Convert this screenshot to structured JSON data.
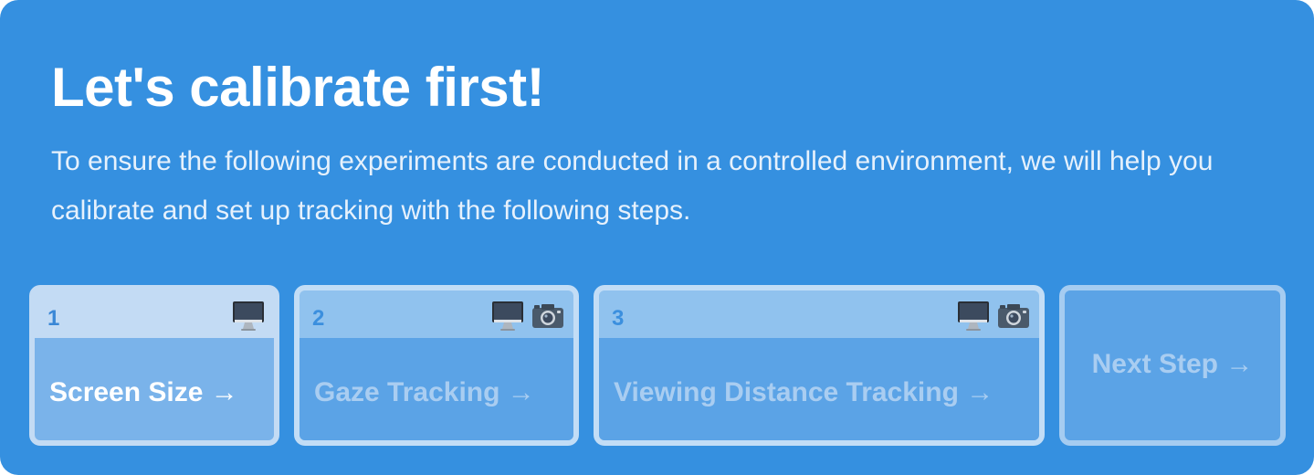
{
  "header": {
    "title": "Let's calibrate first!",
    "description": "To ensure the following experiments are conducted in a controlled environment, we will help you calibrate and set up tracking with the following steps."
  },
  "steps": [
    {
      "number": "1",
      "label": "Screen Size →",
      "icons": [
        "monitor-icon"
      ],
      "active": true
    },
    {
      "number": "2",
      "label": "Gaze Tracking →",
      "icons": [
        "monitor-icon",
        "camera-icon"
      ],
      "active": false
    },
    {
      "number": "3",
      "label": "Viewing Distance Tracking →",
      "icons": [
        "monitor-icon",
        "camera-icon"
      ],
      "active": false
    }
  ],
  "next_button": {
    "label": "Next Step →"
  },
  "colors": {
    "background": "#3590e0",
    "active_step": "#c3dbf4",
    "step_body": "#5ba3e6",
    "step_number": "#3b8fde",
    "text_white": "#ffffff"
  }
}
